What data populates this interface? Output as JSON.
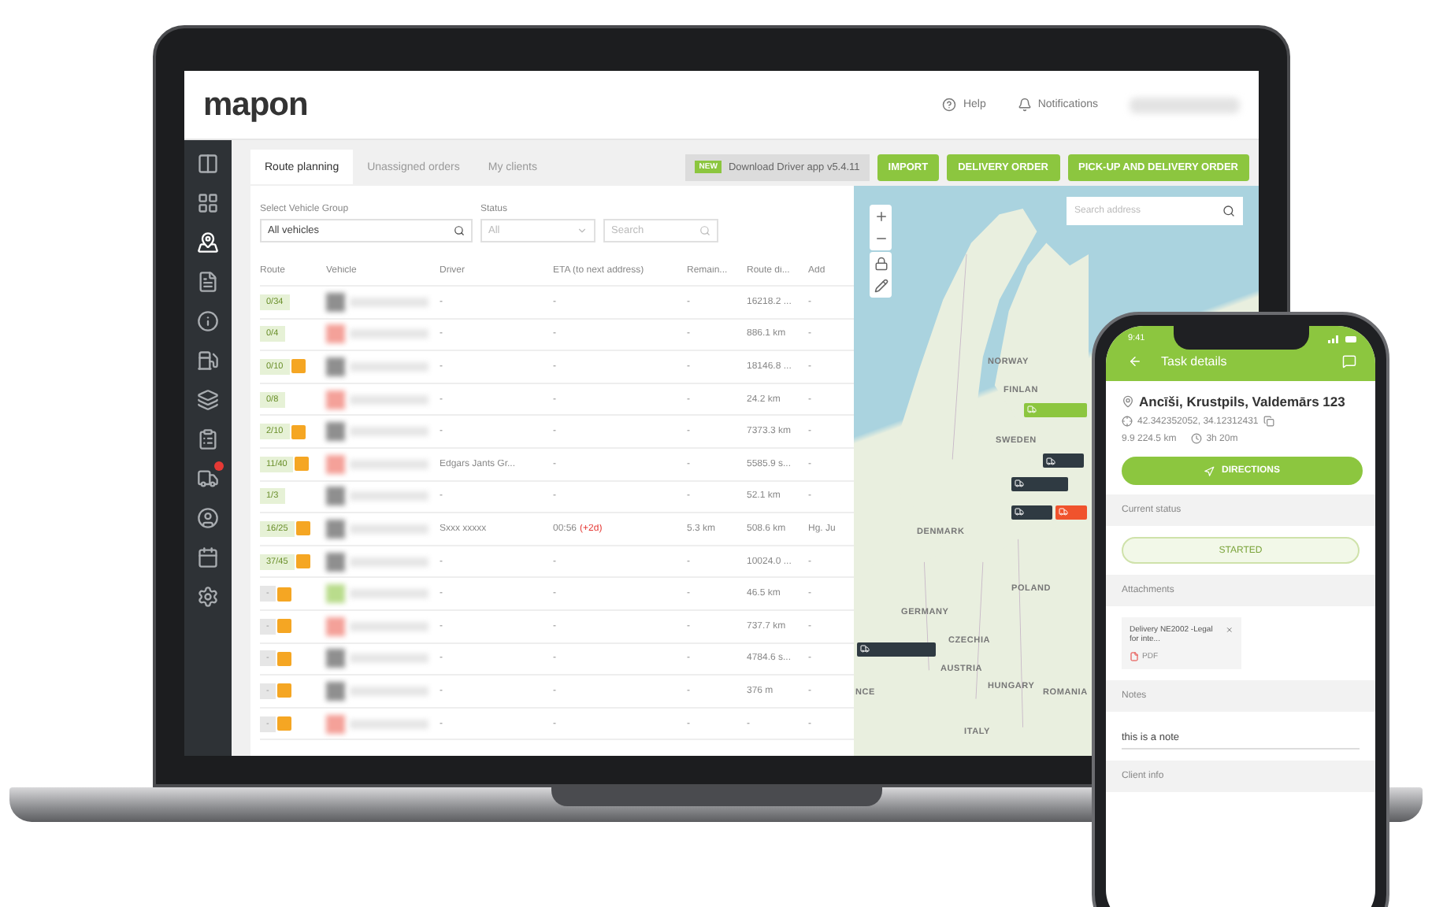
{
  "header": {
    "logo": "mapon",
    "links": [
      {
        "kind": "help",
        "label": "Help"
      },
      {
        "kind": "bell",
        "label": "Notifications"
      }
    ]
  },
  "sidebar": {
    "items": [
      {
        "kind": "columns",
        "selected": false,
        "alert": false
      },
      {
        "kind": "grid",
        "selected": false,
        "alert": false
      },
      {
        "kind": "pins",
        "selected": true,
        "alert": false
      },
      {
        "kind": "file",
        "selected": false,
        "alert": false
      },
      {
        "kind": "info",
        "selected": false,
        "alert": false
      },
      {
        "kind": "fuel",
        "selected": false,
        "alert": false
      },
      {
        "kind": "cards",
        "selected": false,
        "alert": false
      },
      {
        "kind": "clipboard",
        "selected": false,
        "alert": false
      },
      {
        "kind": "truck",
        "selected": false,
        "alert": true
      },
      {
        "kind": "user",
        "selected": false,
        "alert": false
      },
      {
        "kind": "calendar",
        "selected": false,
        "alert": false
      },
      {
        "kind": "settings",
        "selected": false,
        "alert": false
      }
    ]
  },
  "tabs": [
    {
      "label": "Route planning",
      "selected": true
    },
    {
      "label": "Unassigned orders",
      "selected": false
    },
    {
      "label": "My clients",
      "selected": false
    }
  ],
  "banner": {
    "badge": "NEW",
    "text": "Download Driver app v5.4.11"
  },
  "buttons": [
    "IMPORT",
    "DELIVERY ORDER",
    "PICK-UP AND DELIVERY ORDER"
  ],
  "filters": {
    "group_label": "Select Vehicle Group",
    "group_value": "All vehicles",
    "status_label": "Status",
    "status_value": "All",
    "search_placeholder": "Search"
  },
  "table": {
    "columns": [
      "Route",
      "Vehicle",
      "Driver",
      "ETA (to next address)",
      "Remain...",
      "Route di...",
      "Add"
    ],
    "rows": [
      {
        "route": "0/34",
        "started": true,
        "alert": false,
        "color": "#8f8f8f",
        "driver": "-",
        "eta": "-",
        "remaining": "-",
        "distance": "16218.2 ...",
        "address": "-"
      },
      {
        "route": "0/4",
        "started": true,
        "alert": false,
        "color": "#f4a199",
        "driver": "-",
        "eta": "-",
        "remaining": "-",
        "distance": "886.1 km",
        "address": "-"
      },
      {
        "route": "0/10",
        "started": true,
        "alert": true,
        "color": "#8f8f8f",
        "driver": "-",
        "eta": "-",
        "remaining": "-",
        "distance": "18146.8 ...",
        "address": "-"
      },
      {
        "route": "0/8",
        "started": true,
        "alert": false,
        "color": "#f4a199",
        "driver": "-",
        "eta": "-",
        "remaining": "-",
        "distance": "24.2 km",
        "address": "-"
      },
      {
        "route": "2/10",
        "started": true,
        "alert": true,
        "color": "#8f8f8f",
        "driver": "-",
        "eta": "-",
        "remaining": "-",
        "distance": "7373.3 km",
        "address": "-"
      },
      {
        "route": "11/40",
        "started": true,
        "alert": true,
        "color": "#f4a199",
        "driver": "Edgars Jants Gr...",
        "eta": "-",
        "remaining": "-",
        "distance": "5585.9 s...",
        "address": "-"
      },
      {
        "route": "1/3",
        "started": true,
        "alert": false,
        "color": "#8f8f8f",
        "driver": "-",
        "eta": "-",
        "remaining": "-",
        "distance": "52.1 km",
        "address": "-"
      },
      {
        "route": "16/25",
        "started": true,
        "alert": true,
        "color": "#8f8f8f",
        "driver": "Sxxx xxxxx",
        "eta": "00:56",
        "eta_delay": "(+2d)",
        "remaining": "5.3 km",
        "distance": "508.6 km",
        "address": "Hg. Ju"
      },
      {
        "route": "37/45",
        "started": true,
        "alert": true,
        "color": "#8f8f8f",
        "driver": "-",
        "eta": "-",
        "remaining": "-",
        "distance": "10024.0 ...",
        "address": "-"
      },
      {
        "route": "-",
        "started": false,
        "alert": true,
        "color": "#b9dc8c",
        "driver": "-",
        "eta": "-",
        "remaining": "-",
        "distance": "46.5 km",
        "address": "-"
      },
      {
        "route": "-",
        "started": false,
        "alert": true,
        "color": "#f4a199",
        "driver": "-",
        "eta": "-",
        "remaining": "-",
        "distance": "737.7 km",
        "address": "-"
      },
      {
        "route": "-",
        "started": false,
        "alert": true,
        "color": "#8f8f8f",
        "driver": "-",
        "eta": "-",
        "remaining": "-",
        "distance": "4784.6 s...",
        "address": "-"
      },
      {
        "route": "-",
        "started": false,
        "alert": true,
        "color": "#8f8f8f",
        "driver": "-",
        "eta": "-",
        "remaining": "-",
        "distance": "376 m",
        "address": "-"
      },
      {
        "route": "-",
        "started": false,
        "alert": true,
        "color": "#f4a199",
        "driver": "-",
        "eta": "-",
        "remaining": "-",
        "distance": "-",
        "address": "-"
      }
    ]
  },
  "map": {
    "search_placeholder": "Search address",
    "labels": [
      "NORWAY",
      "FINLAN",
      "SWEDEN",
      "DENMARK",
      "POLAND",
      "GERMANY",
      "CZECHIA",
      "AUSTRIA",
      "HUNGARY",
      "ROMANIA",
      "ITALY",
      "NCE"
    ],
    "markers": [
      {
        "color": "#8cc63f"
      },
      {
        "color": "#2f3a42"
      },
      {
        "color": "#2f3a42"
      },
      {
        "color": "#2f3a42"
      },
      {
        "color": "#f0532d"
      },
      {
        "color": "#2f3a42"
      }
    ]
  },
  "phone": {
    "time": "9:41",
    "title": "Task details",
    "address": "Ancīši, Krustpils, Valdemārs 123",
    "coordinates": "42.342352052, 34.12312431",
    "distance": "9.9 224.5 km",
    "duration": "3h 20m",
    "directions": "DIRECTIONS",
    "sections": [
      {
        "title": "Current status",
        "kind": "status",
        "value": "STARTED"
      },
      {
        "title": "Attachments",
        "kind": "attachment",
        "value": "Delivery NE2002 -Legal for inte...",
        "file_type": "PDF"
      },
      {
        "title": "Notes",
        "kind": "note",
        "value": "this is a note"
      },
      {
        "title": "Client info",
        "kind": "empty"
      }
    ]
  }
}
